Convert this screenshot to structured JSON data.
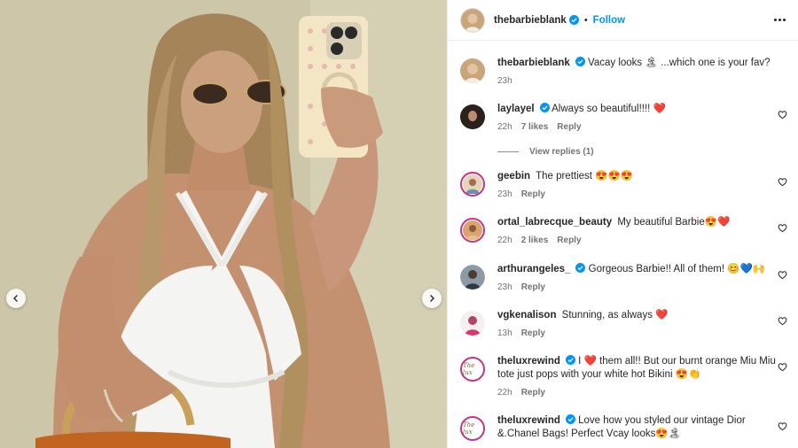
{
  "post": {
    "author": "thebarbieblank",
    "follow_label": "Follow",
    "more_label": "More options",
    "dot_separator": "•"
  },
  "caption": {
    "user": "thebarbieblank",
    "text": "Vacay looks 🏝 ...which one is your fav?",
    "time": "23h"
  },
  "comments": [
    {
      "user": "laylayel",
      "verified": true,
      "text": "Always so beautiful!!!! ❤️",
      "time": "22h",
      "likes": "7 likes",
      "reply": "Reply",
      "view_replies": "View replies (1)"
    },
    {
      "user": "geebin",
      "verified": false,
      "text": "The prettiest 😍😍😍",
      "time": "23h",
      "likes": "",
      "reply": "Reply"
    },
    {
      "user": "ortal_labrecque_beauty",
      "verified": false,
      "text": "My beautiful Barbie😍❤️",
      "time": "22h",
      "likes": "2 likes",
      "reply": "Reply"
    },
    {
      "user": "arthurangeles_",
      "verified": true,
      "text": "Gorgeous Barbie!! All of them! 😊💙🙌",
      "time": "23h",
      "likes": "",
      "reply": "Reply"
    },
    {
      "user": "vgkenalison",
      "verified": false,
      "text": "Stunning, as always ❤️",
      "time": "13h",
      "likes": "",
      "reply": "Reply"
    },
    {
      "user": "theluxrewind",
      "verified": true,
      "text": "I ❤️ them all!! But our burnt orange Miu Miu tote just pops with your white hot Bikini 😍👏",
      "time": "22h",
      "likes": "",
      "reply": "Reply"
    },
    {
      "user": "theluxrewind",
      "verified": true,
      "text": "Love how you styled our vintage Dior &.Chanel Bags! Perfect Vcay looks😍🏝",
      "time": "",
      "likes": "",
      "reply": ""
    }
  ],
  "brand": {
    "luxrewind_logo_text": "The lux"
  },
  "colors": {
    "accent": "#0095f6",
    "verified": "#0095f6",
    "heart": "#ed4956",
    "meta": "#737373"
  },
  "icons": {
    "prev": "chevron-left-icon",
    "next": "chevron-right-icon",
    "like": "heart-outline-icon",
    "more": "more-horizontal-icon"
  }
}
